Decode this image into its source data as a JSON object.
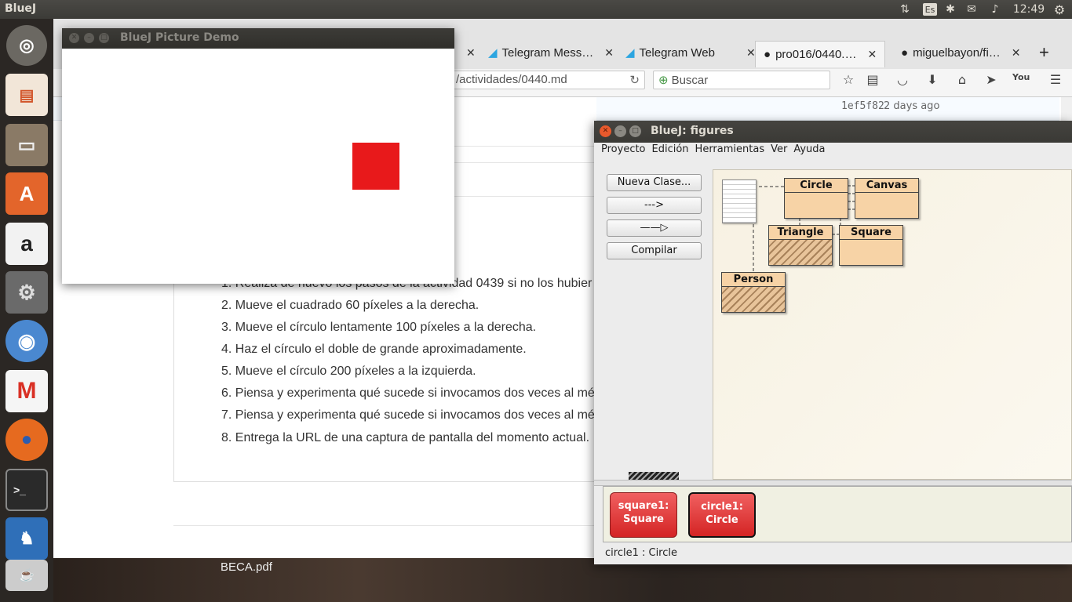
{
  "topbar": {
    "app": "BlueJ",
    "keyboard": "Es",
    "clock": "12:49"
  },
  "firefox": {
    "tabs": [
      "Telegram Mess…",
      "Telegram Web",
      "pro016/0440.…",
      "miguelbayon/fi…"
    ],
    "url": "/actividades/0440.md",
    "search_placeholder": "Buscar",
    "commit": "1ef5f82",
    "commit_age": "2 days ago",
    "list": [
      "1. Realiza de nuevo los pasos de la actividad 0439 si no los hubier",
      "2. Mueve el cuadrado 60 píxeles a la derecha.",
      "3. Mueve el círculo lentamente 100 píxeles a la derecha.",
      "4. Haz el círculo el doble de grande aproximadamente.",
      "5. Mueve el círculo 200 píxeles a la izquierda.",
      "6. Piensa y experimenta qué sucede si invocamos dos veces al mé",
      "7. Piensa y experimenta qué sucede si invocamos dos veces al mé",
      "8. Entrega la URL de una captura de pantalla del momento actual."
    ],
    "download": "BECA.pdf"
  },
  "picture_demo": {
    "title": "BlueJ Picture Demo",
    "shape_color": "#e8191b"
  },
  "bluej": {
    "title": "BlueJ:  figures",
    "menu": [
      "Proyecto",
      "Edición",
      "Herramientas",
      "Ver",
      "Ayuda"
    ],
    "buttons": {
      "new_class": "Nueva Clase...",
      "dep_arrow": "--->",
      "inh_arrow": "——▷",
      "compile": "Compilar"
    },
    "classes": {
      "circle": "Circle",
      "canvas": "Canvas",
      "triangle": "Triangle",
      "square": "Square",
      "person": "Person"
    },
    "objects": [
      {
        "name": "square1:",
        "type": "Square"
      },
      {
        "name": "circle1:",
        "type": "Circle"
      }
    ],
    "status": "circle1 : Circle"
  }
}
